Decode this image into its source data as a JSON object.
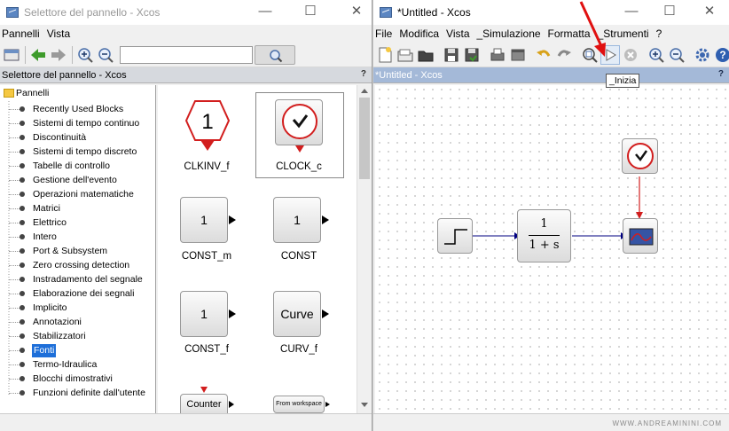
{
  "left_window": {
    "title": "Selettore del pannello - Xcos",
    "menus": [
      "Pannelli",
      "Vista"
    ],
    "search": {
      "value": ""
    },
    "header": "Selettore del pannello - Xcos",
    "help": "?",
    "tree_root": "Pannelli",
    "tree_items": [
      "Recently Used Blocks",
      "Sistemi di tempo continuo",
      "Discontinuità",
      "Sistemi di tempo discreto",
      "Tabelle di controllo",
      "Gestione dell'evento",
      "Operazioni matematiche",
      "Matrici",
      "Elettrico",
      "Intero",
      "Port & Subsystem",
      "Zero crossing detection",
      "Instradamento del segnale",
      "Elaborazione dei segnali",
      "Implicito",
      "Annotazioni",
      "Stabilizzatori",
      "Fonti",
      "Termo-Idraulica",
      "Blocchi dimostrativi",
      "Funzioni definite dall'utente"
    ],
    "selected_item": "Fonti",
    "blocks": [
      {
        "name": "CLKINV_f",
        "glyph": "1"
      },
      {
        "name": "CLOCK_c",
        "glyph": ""
      },
      {
        "name": "CONST_m",
        "glyph": "1"
      },
      {
        "name": "CONST",
        "glyph": "1"
      },
      {
        "name": "CONST_f",
        "glyph": "1"
      },
      {
        "name": "CURV_f",
        "glyph": "Curve"
      },
      {
        "name": "",
        "glyph": "Counter"
      },
      {
        "name": "",
        "glyph": "From workspace"
      }
    ]
  },
  "right_window": {
    "title": "*Untitled - Xcos",
    "menus": [
      "File",
      "Modifica",
      "Vista",
      "_Simulazione",
      "Formatta",
      "_Strumenti",
      "?"
    ],
    "header": "*Untitled - Xcos",
    "help": "?",
    "tooltip": "_Inizia",
    "diagram": {
      "tf_num": "1",
      "tf_den": "1 + s"
    }
  },
  "watermark": "WWW.ANDREAMININI.COM",
  "colors": {
    "accent": "#d21e1e",
    "header_bg": "#d6d9de",
    "canvas_header": "#a4b9d8",
    "link": "#000080"
  }
}
